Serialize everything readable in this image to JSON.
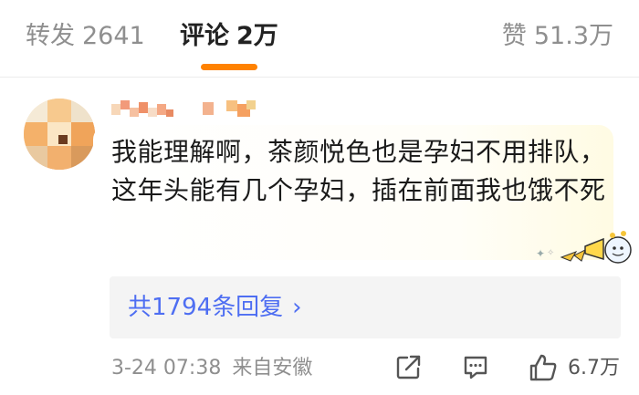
{
  "tabs": {
    "repost": {
      "label": "转发",
      "count": "2641"
    },
    "comments": {
      "label": "评论",
      "count": "2万"
    },
    "likes": {
      "label": "赞",
      "count": "51.3万"
    }
  },
  "comment": {
    "text": "我能理解啊，茶颜悦色也是孕妇不用排队，这年头能有几个孕妇，插在前面我也饿不死",
    "replies_label": "共1794条回复",
    "timestamp": "3-24 07:38",
    "source": "来自安徽",
    "like_count": "6.7万"
  },
  "colors": {
    "accent": "#ff8200",
    "link": "#4e6ef2",
    "muted": "#8f8f8f"
  },
  "icons": [
    "share-icon",
    "comment-icon",
    "thumbs-up-icon",
    "chevron-right-icon"
  ]
}
